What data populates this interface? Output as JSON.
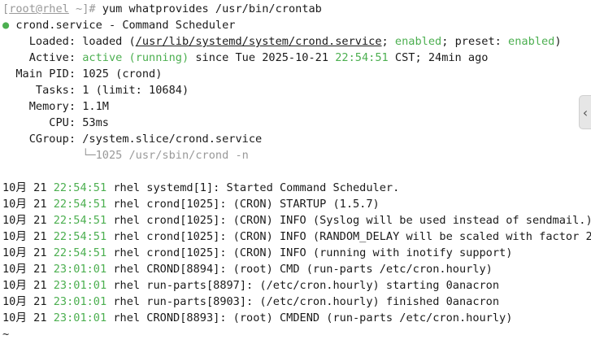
{
  "prompt": {
    "open": "[",
    "user_host": "root@rhel",
    "dir": " ~",
    "close": "]#",
    "command": " yum whatprovides /usr/bin/crontab"
  },
  "service": {
    "dot": "●",
    "name": " crond.service - Command Scheduler",
    "loaded_label": "    Loaded: ",
    "loaded_a": "loaded (",
    "loaded_path": "/usr/lib/systemd/system/crond.service",
    "loaded_b": "; ",
    "enabled": "enabled",
    "loaded_c": "; preset: ",
    "preset": "enabled",
    "loaded_d": ")",
    "active_label": "    Active: ",
    "active_state": "active (running)",
    "active_since": " since Tue 2025-10-21 ",
    "active_time": "22:54:51",
    "active_rest": " CST; 24min ago",
    "mainpid": "  Main PID: 1025 (crond)",
    "tasks": "     Tasks: 1 (limit: 10684)",
    "memory": "    Memory: 1.1M",
    "cpu": "       CPU: 53ms",
    "cgroup": "    CGroup: /system.slice/crond.service",
    "cgroup_child": "            └─1025 /usr/sbin/crond -n"
  },
  "logs": [
    {
      "date": "10月 21 ",
      "time": "22:54:51",
      "msg": " rhel systemd[1]: Started Command Scheduler."
    },
    {
      "date": "10月 21 ",
      "time": "22:54:51",
      "msg": " rhel crond[1025]: (CRON) STARTUP (1.5.7)"
    },
    {
      "date": "10月 21 ",
      "time": "22:54:51",
      "msg": " rhel crond[1025]: (CRON) INFO (Syslog will be used instead of sendmail.)"
    },
    {
      "date": "10月 21 ",
      "time": "22:54:51",
      "msg": " rhel crond[1025]: (CRON) INFO (RANDOM_DELAY will be scaled with factor 2",
      "cursor": ">"
    },
    {
      "date": "10月 21 ",
      "time": "22:54:51",
      "msg": " rhel crond[1025]: (CRON) INFO (running with inotify support)"
    },
    {
      "date": "10月 21 ",
      "time": "23:01:01",
      "msg": " rhel CROND[8894]: (root) CMD (run-parts /etc/cron.hourly)"
    },
    {
      "date": "10月 21 ",
      "time": "23:01:01",
      "msg": " rhel run-parts[8897]: (/etc/cron.hourly) starting 0anacron"
    },
    {
      "date": "10月 21 ",
      "time": "23:01:01",
      "msg": " rhel run-parts[8903]: (/etc/cron.hourly) finished 0anacron"
    },
    {
      "date": "10月 21 ",
      "time": "23:01:01",
      "msg": " rhel CROND[8893]: (root) CMDEND (run-parts /etc/cron.hourly)"
    }
  ],
  "pager_tilde": "~",
  "side_handle": "‹"
}
